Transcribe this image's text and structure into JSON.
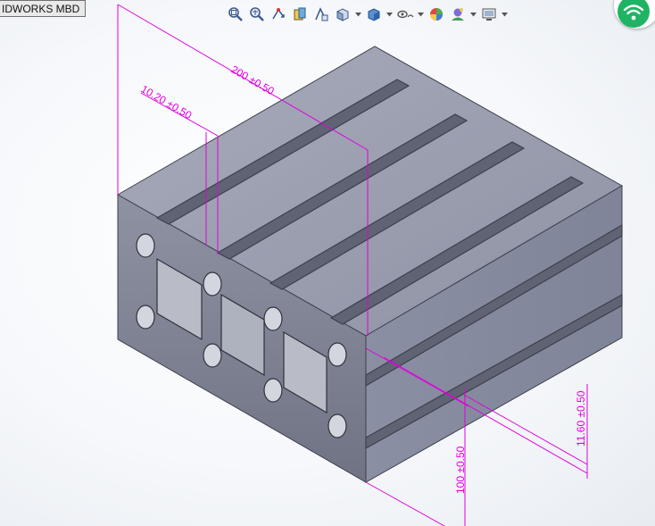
{
  "tab": {
    "label": "IDWORKS MBD"
  },
  "toolbar": {
    "buttons": [
      {
        "name": "zoom-to-fit-icon"
      },
      {
        "name": "zoom-to-area-icon"
      },
      {
        "name": "previous-view-icon"
      },
      {
        "name": "section-view-icon"
      },
      {
        "name": "dynamic-annotation-icon"
      },
      {
        "name": "view-orientation-icon"
      },
      {
        "name": "display-style-icon"
      },
      {
        "name": "hide-show-items-icon"
      },
      {
        "name": "edit-appearance-icon"
      },
      {
        "name": "apply-scene-icon"
      },
      {
        "name": "view-settings-icon"
      }
    ]
  },
  "dimensions": {
    "length": "200 ±0.50",
    "slot_offset": "10.20 ±0.50",
    "height": "100 ±0.50",
    "edge_height": "11.60 ±0.50"
  },
  "colors": {
    "dimension": "#e000e0",
    "profile_face": "#9ea3b4",
    "profile_dark": "#5d6070",
    "badge": "#1fb463"
  }
}
